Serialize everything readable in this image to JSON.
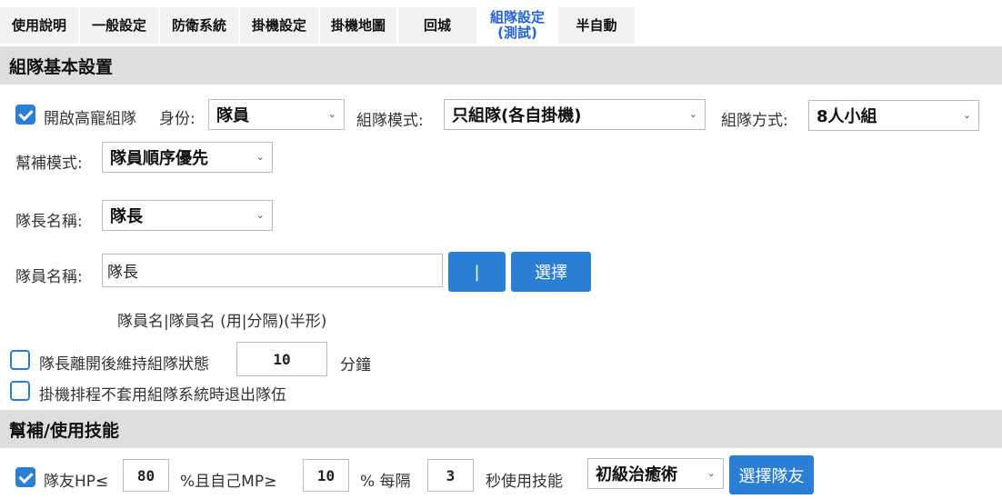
{
  "tabs": [
    {
      "label": "使用說明"
    },
    {
      "label": "一般設定"
    },
    {
      "label": "防衛系統"
    },
    {
      "label": "掛機設定"
    },
    {
      "label": "掛機地圖"
    },
    {
      "label": "回城"
    },
    {
      "label_line1": "組隊設定",
      "label_line2": "(測試)"
    },
    {
      "label": "半自動"
    }
  ],
  "section_basic": {
    "title": "組隊基本設置"
  },
  "enable_team": {
    "label": "開啟高寵組隊",
    "checked": true
  },
  "role": {
    "label": "身份:",
    "value": "隊員"
  },
  "team_mode": {
    "label": "組隊模式:",
    "value": "只組隊(各自掛機)"
  },
  "team_method": {
    "label": "組隊方式:",
    "value": "8人小組"
  },
  "assist_mode": {
    "label": "幫補模式:",
    "value": "隊員順序優先"
  },
  "leader_name": {
    "label": "隊長名稱:",
    "value": "隊長"
  },
  "member_name": {
    "label": "隊員名稱:",
    "value": "隊長",
    "sep_button": "|",
    "select_button": "選擇",
    "hint": "隊員名|隊員名 (用|分隔)(半形)"
  },
  "keep_team": {
    "label": "隊長離開後維持組隊狀態",
    "minutes": "10",
    "unit": "分鐘",
    "checked": false
  },
  "exit_team": {
    "label": "掛機排程不套用組隊系統時退出隊伍",
    "checked": false
  },
  "section_skill": {
    "title": "幫補/使用技能"
  },
  "skill_row": {
    "label_hp": "隊友HP≤",
    "hp": "80",
    "label_mp": "%且自己MP≥",
    "mp": "10",
    "label_every": "% 每隔",
    "seconds": "3",
    "label_use": "秒使用技能",
    "skill": "初級治癒術",
    "choose_button": "選擇隊友",
    "checked": true
  },
  "colors": {
    "accent": "#2b7ed6",
    "active_tab_text": "#2563d9",
    "header_bg": "#dedede",
    "tab_bg": "#f2f2f2"
  }
}
